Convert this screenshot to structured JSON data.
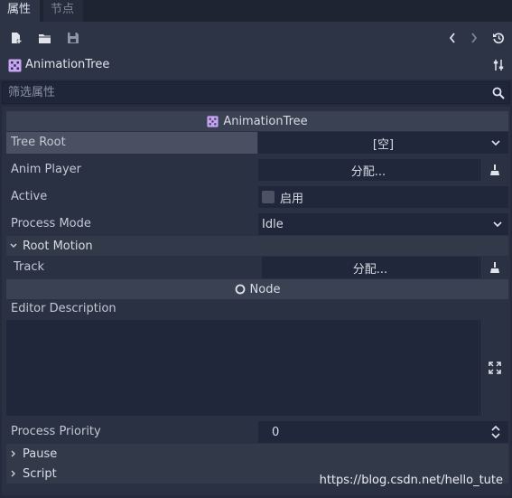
{
  "tabs": [
    {
      "label": "属性"
    },
    {
      "label": "节点"
    }
  ],
  "object": {
    "name": "AnimationTree"
  },
  "filter": {
    "placeholder": "筛选属性"
  },
  "section": {
    "title": "AnimationTree"
  },
  "props": {
    "tree_root": {
      "label": "Tree Root",
      "value": "[空]"
    },
    "anim_player": {
      "label": "Anim Player",
      "value": "分配..."
    },
    "active": {
      "label": "Active",
      "checkbox_label": "启用",
      "checked": false
    },
    "process_mode": {
      "label": "Process Mode",
      "value": "Idle"
    },
    "root_motion": {
      "label": "Root Motion"
    },
    "track": {
      "label": "Track",
      "value": "分配..."
    },
    "node_section": {
      "label": "Node"
    },
    "editor_description": {
      "label": "Editor Description",
      "value": ""
    },
    "process_priority": {
      "label": "Process Priority",
      "value": "0"
    },
    "pause": {
      "label": "Pause"
    },
    "script": {
      "label": "Script"
    }
  },
  "watermark": "https://blog.csdn.net/hello_tute",
  "colors": {
    "accent_icon": "#c9a4f5",
    "background": "#252b3a",
    "field": "#21273a"
  }
}
